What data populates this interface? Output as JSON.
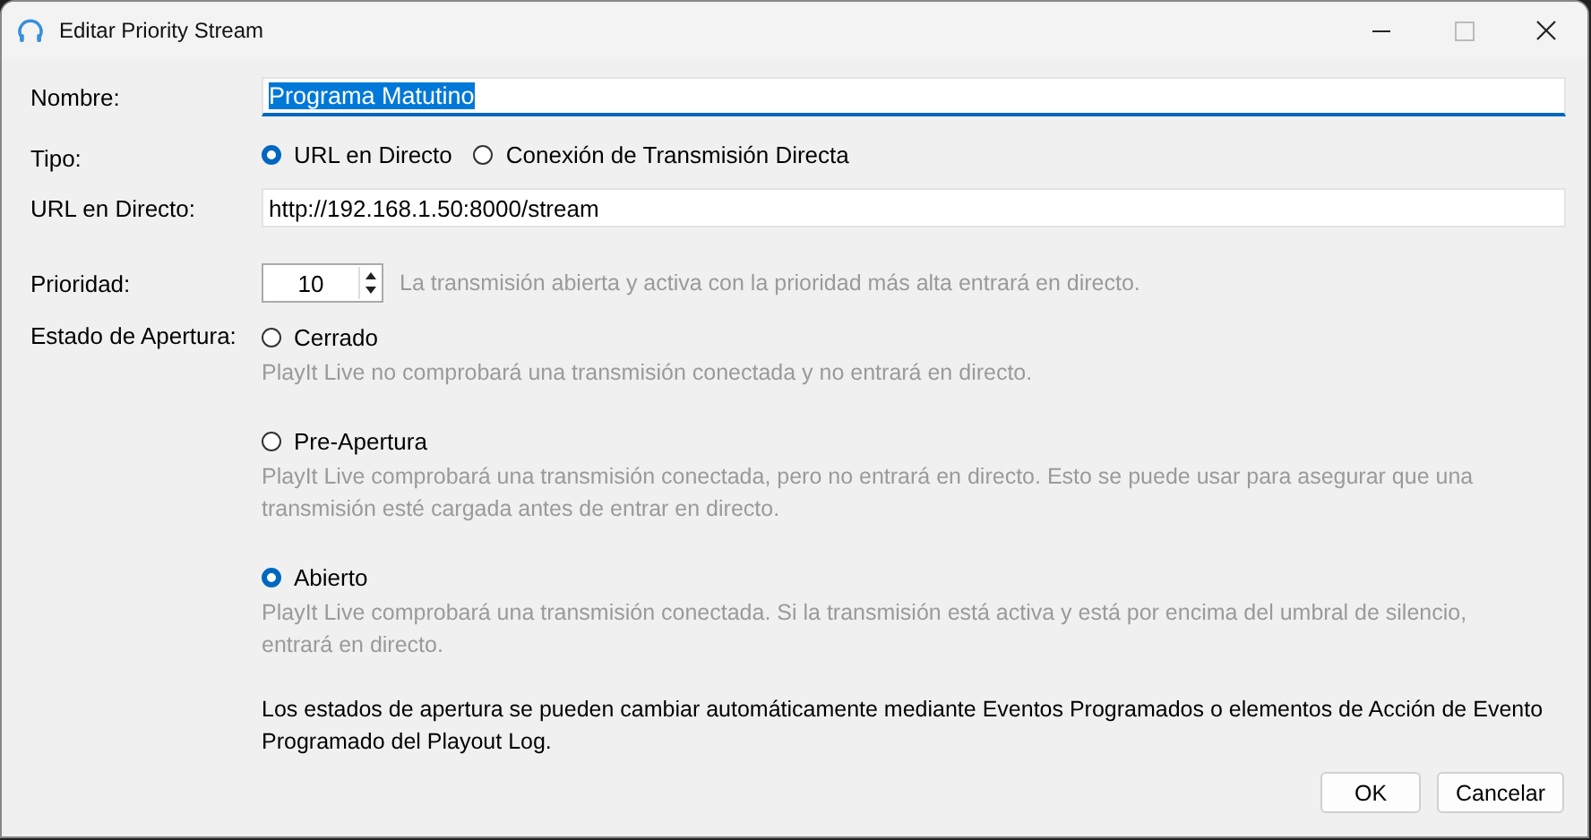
{
  "window": {
    "title": "Editar Priority Stream"
  },
  "name_field": {
    "label": "Nombre:",
    "value": "Programa Matutino"
  },
  "type": {
    "label": "Tipo:",
    "options": [
      {
        "label": "URL en Directo",
        "selected": true
      },
      {
        "label": "Conexión de Transmisión Directa",
        "selected": false
      }
    ]
  },
  "url_field": {
    "label": "URL en Directo:",
    "value": "http://192.168.1.50:8000/stream"
  },
  "priority": {
    "label": "Prioridad:",
    "value": "10",
    "hint": "La transmisión abierta y activa con la prioridad más alta entrará en directo."
  },
  "open_state": {
    "label": "Estado de Apertura:",
    "options": [
      {
        "label": "Cerrado",
        "selected": false,
        "description": "PlayIt Live no comprobará una transmisión conectada y no entrará en directo."
      },
      {
        "label": "Pre-Apertura",
        "selected": false,
        "description": "PlayIt Live comprobará una transmisión conectada, pero no entrará en directo. Esto se puede usar para asegurar que una transmisión esté cargada antes de entrar en directo."
      },
      {
        "label": "Abierto",
        "selected": true,
        "description": "PlayIt Live comprobará una transmisión conectada. Si la transmisión está activa y está por encima del umbral de silencio, entrará en directo."
      }
    ],
    "note": "Los estados de apertura se pueden cambiar automáticamente mediante Eventos Programados o elementos de Acción de Evento Programado del Playout Log."
  },
  "buttons": [
    "OK",
    "Cancelar"
  ]
}
